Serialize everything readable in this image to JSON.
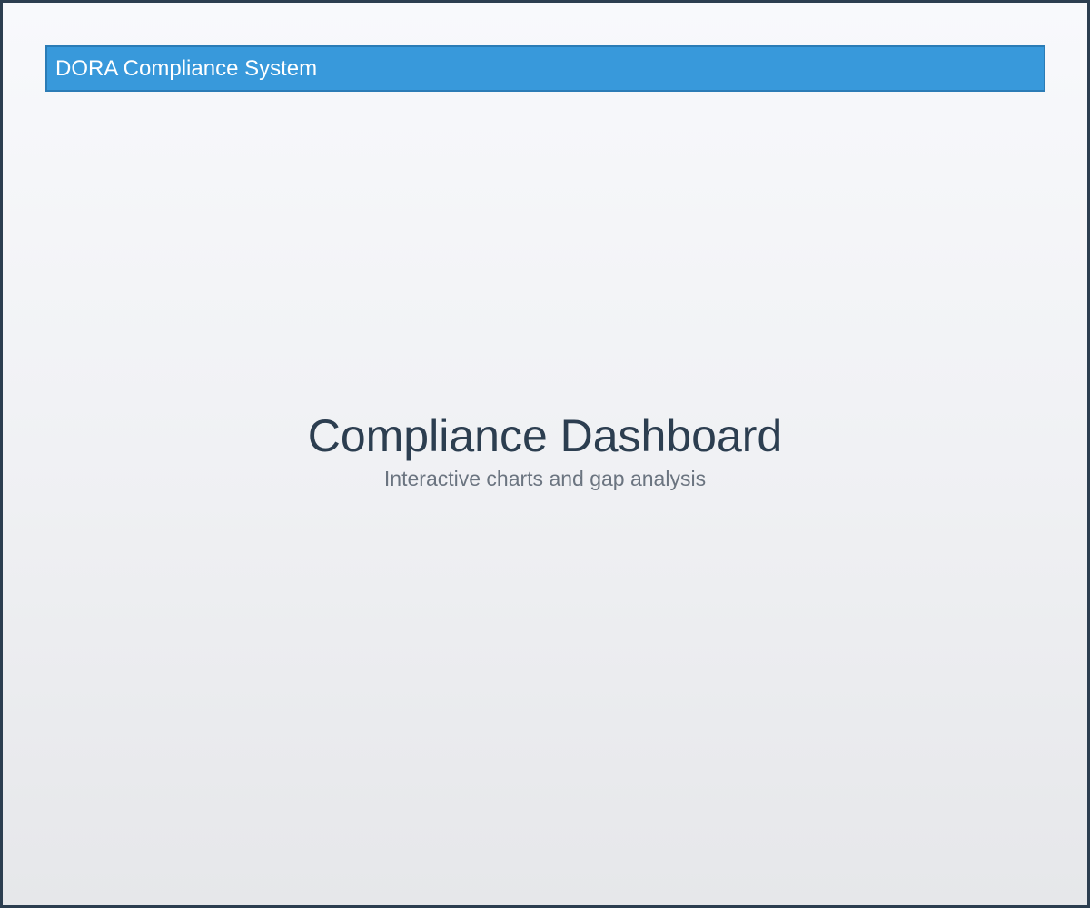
{
  "header": {
    "app_title": "DORA Compliance System"
  },
  "main": {
    "title": "Compliance Dashboard",
    "subtitle": "Interactive charts and gap analysis"
  },
  "colors": {
    "header_bg": "#3899db",
    "header_border": "#2b7cb6",
    "frame_border": "#2c3e50",
    "title_text": "#2c3e50",
    "subtitle_text": "#6b7480"
  }
}
